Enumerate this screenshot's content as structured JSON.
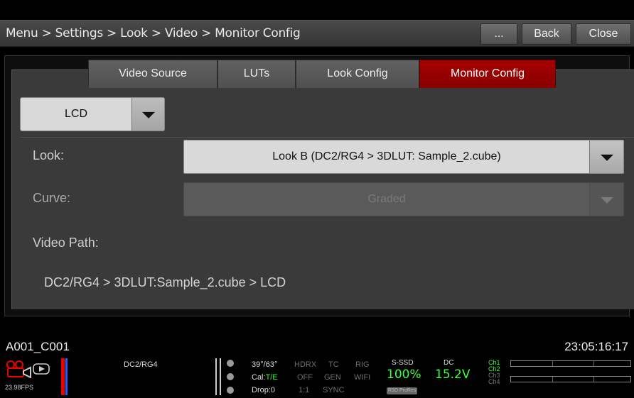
{
  "header": {
    "breadcrumb": "Menu > Settings > Look > Video > Monitor Config",
    "more_label": "...",
    "back_label": "Back",
    "close_label": "Close"
  },
  "tabs": [
    {
      "label": "Video Source",
      "active": false
    },
    {
      "label": "LUTs",
      "active": false
    },
    {
      "label": "Look Config",
      "active": false
    },
    {
      "label": "Monitor Config",
      "active": true
    }
  ],
  "monitor_select": {
    "value": "LCD"
  },
  "look": {
    "label": "Look:",
    "value": "Look B (DC2/RG4 > 3DLUT: Sample_2.cube)"
  },
  "curve": {
    "label": "Curve:",
    "value": "Graded",
    "disabled": true
  },
  "video_path": {
    "label": "Video Path:",
    "value": "DC2/RG4 > 3DLUT:Sample_2.cube > LCD"
  },
  "status": {
    "clip_name": "A001_C001",
    "timecode": "23:05:16:17",
    "fps": "23.98FPS",
    "look_name": "DC2/RG4",
    "temp": "39°/63°",
    "cal_label": "Cal:",
    "cal_value": "T/E",
    "drop": "Drop:0",
    "hdrx": "HDRX",
    "hdrx_value": "OFF",
    "hdrx_ratio": "1:1",
    "tc": "TC",
    "tc_value": "GEN",
    "tc_sync": "SYNC",
    "rig": "RIG",
    "rig_value": "WIFI",
    "media_label": "S-SSD",
    "media_value": "100%",
    "badge_r3d": "R3D",
    "badge_prores": "ProRes",
    "power_label": "DC",
    "power_value": "15.2V",
    "channels": [
      "Ch1",
      "Ch2",
      "Ch3",
      "Ch4"
    ]
  },
  "colors": {
    "accent_tab": "#a00000",
    "ok_green": "#33ff33",
    "record_red": "#ee0000"
  }
}
